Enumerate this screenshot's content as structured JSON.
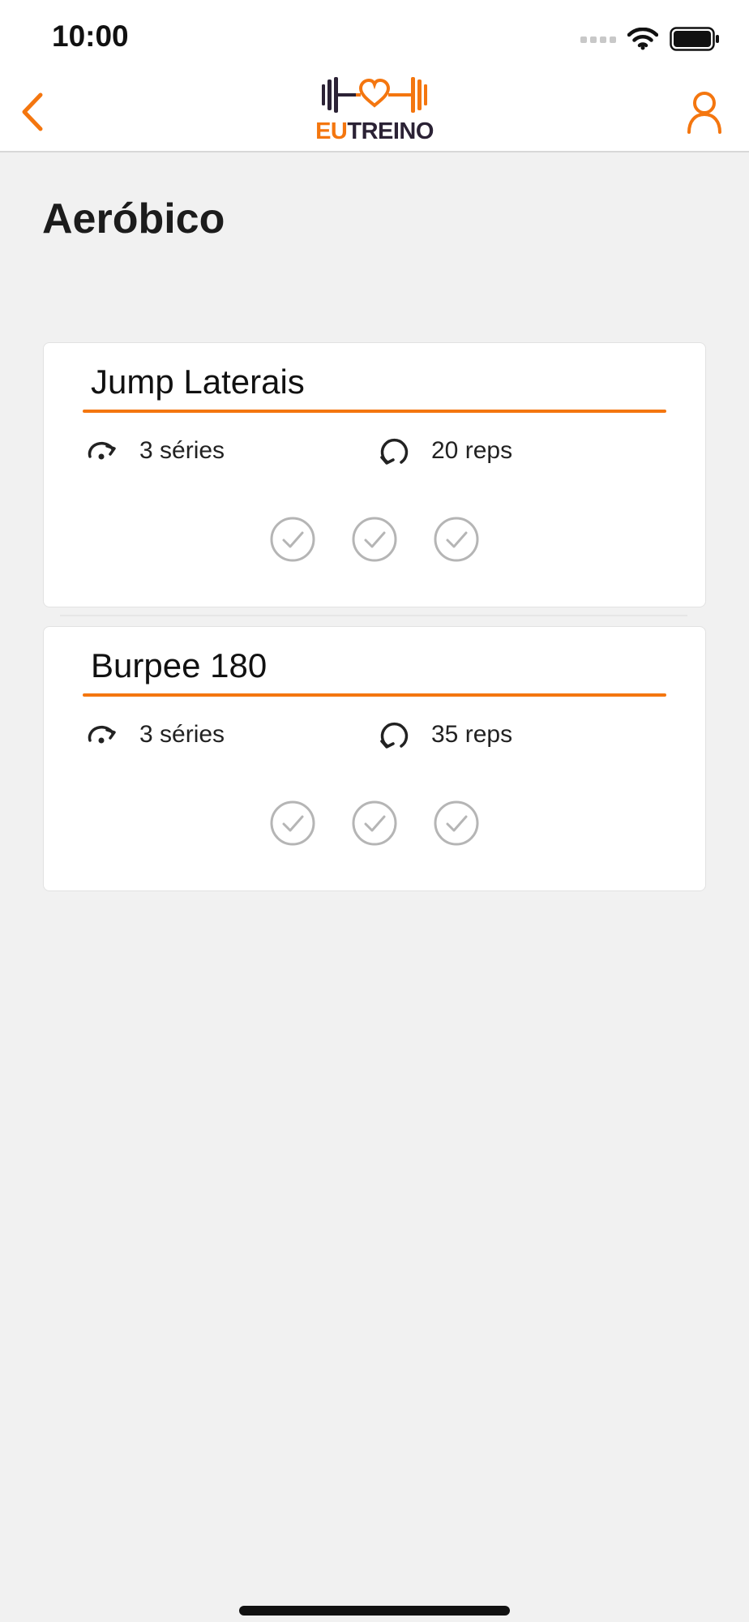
{
  "status_bar": {
    "time": "10:00"
  },
  "nav": {
    "logo": {
      "part_1": "EU",
      "part_2": "TREINO"
    },
    "back_icon": "chevron-left-icon",
    "profile_icon": "user-icon"
  },
  "page": {
    "title": "Aeróbico"
  },
  "exercises": [
    {
      "name": "Jump Laterais",
      "series": "3 séries",
      "reps": "20 reps",
      "sets_total": 3,
      "sets_done": 0
    },
    {
      "name": "Burpee 180",
      "series": "3 séries",
      "reps": "35 reps",
      "sets_total": 3,
      "sets_done": 0
    }
  ],
  "colors": {
    "accent": "#f4760f",
    "brand_dark": "#2b2235",
    "check_gray": "#b5b5b5",
    "background": "#f1f1f1"
  }
}
